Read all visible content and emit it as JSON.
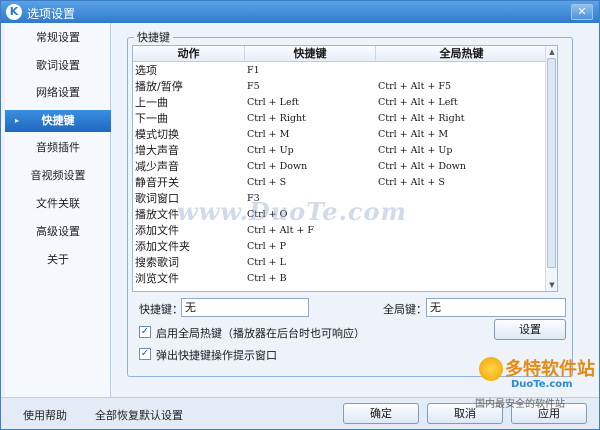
{
  "window": {
    "title": "选项设置",
    "icon_letter": "K",
    "close_label": "✕"
  },
  "sidebar": {
    "items": [
      {
        "label": "常规设置"
      },
      {
        "label": "歌词设置"
      },
      {
        "label": "网络设置"
      },
      {
        "label": "快捷键",
        "active": true
      },
      {
        "label": "音频插件"
      },
      {
        "label": "音视频设置"
      },
      {
        "label": "文件关联"
      },
      {
        "label": "高级设置"
      },
      {
        "label": "关于"
      }
    ]
  },
  "shortcuts": {
    "group_title": "快捷键",
    "columns": {
      "action": "动作",
      "key": "快捷键",
      "global": "全局热键"
    },
    "rows": [
      {
        "action": "选项",
        "key": "F1",
        "global": ""
      },
      {
        "action": "播放/暂停",
        "key": "F5",
        "global": "Ctrl + Alt + F5"
      },
      {
        "action": "上一曲",
        "key": "Ctrl + Left",
        "global": "Ctrl + Alt + Left"
      },
      {
        "action": "下一曲",
        "key": "Ctrl + Right",
        "global": "Ctrl + Alt + Right"
      },
      {
        "action": "模式切换",
        "key": "Ctrl + M",
        "global": "Ctrl + Alt + M"
      },
      {
        "action": "增大声音",
        "key": "Ctrl + Up",
        "global": "Ctrl + Alt + Up"
      },
      {
        "action": "减少声音",
        "key": "Ctrl + Down",
        "global": "Ctrl + Alt + Down"
      },
      {
        "action": "静音开关",
        "key": "Ctrl + S",
        "global": "Ctrl + Alt + S"
      },
      {
        "action": "歌词窗口",
        "key": "F3",
        "global": ""
      },
      {
        "action": "播放文件",
        "key": "Ctrl + O",
        "global": ""
      },
      {
        "action": "添加文件",
        "key": "Ctrl + Alt + F",
        "global": ""
      },
      {
        "action": "添加文件夹",
        "key": "Ctrl + P",
        "global": ""
      },
      {
        "action": "搜索歌词",
        "key": "Ctrl + L",
        "global": ""
      },
      {
        "action": "浏览文件",
        "key": "Ctrl + B",
        "global": ""
      }
    ],
    "shortcut_label": "快捷键：",
    "shortcut_value": "无",
    "global_label": "全局键：",
    "global_value": "无",
    "set_button": "设置",
    "option_enable_global": {
      "label": "启用全局热键（播放器在后台时也可响应）",
      "checked": true
    },
    "option_popup": {
      "label": "弹出快捷键操作提示窗口",
      "checked": true
    }
  },
  "watermark": "www.DuoTe.com",
  "footer": {
    "help": "使用帮助",
    "restore": "全部恢复默认设置",
    "ok": "确定",
    "cancel": "取消",
    "apply": "应用"
  },
  "brand": {
    "main": "多特软件站",
    "sub": "DuoTe.com",
    "tag": "国内最安全的软件站"
  }
}
